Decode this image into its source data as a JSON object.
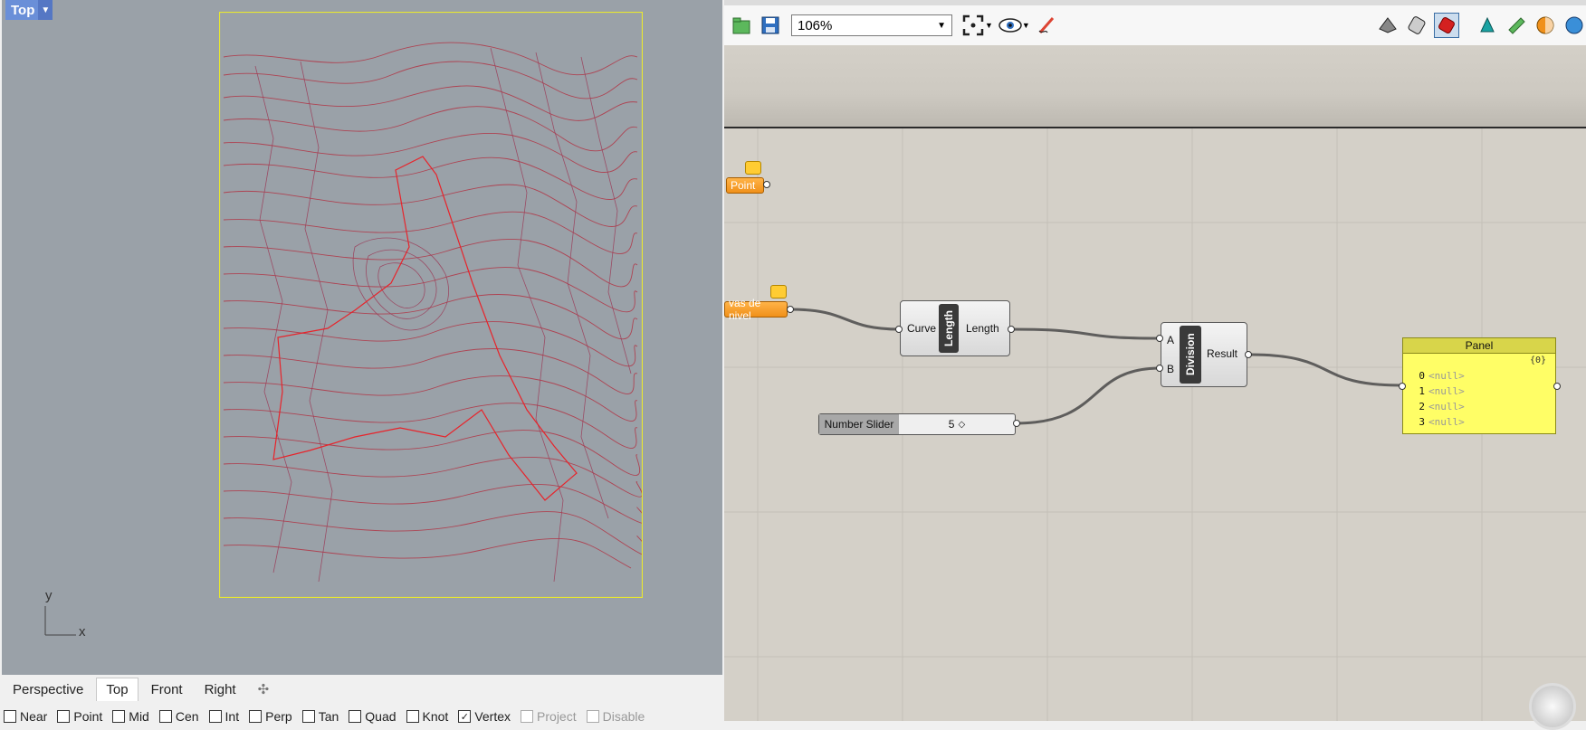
{
  "rhino": {
    "viewport_title": "Top",
    "axis_x": "x",
    "axis_y": "y",
    "viewport_tabs": [
      "Perspective",
      "Top",
      "Front",
      "Right"
    ],
    "active_tab": "Top",
    "osnaps": [
      {
        "label": "Near",
        "checked": false
      },
      {
        "label": "Point",
        "checked": false
      },
      {
        "label": "Mid",
        "checked": false
      },
      {
        "label": "Cen",
        "checked": false
      },
      {
        "label": "Int",
        "checked": false
      },
      {
        "label": "Perp",
        "checked": false
      },
      {
        "label": "Tan",
        "checked": false
      },
      {
        "label": "Quad",
        "checked": false
      },
      {
        "label": "Knot",
        "checked": false
      },
      {
        "label": "Vertex",
        "checked": true
      },
      {
        "label": "Project",
        "checked": false,
        "disabled": true
      },
      {
        "label": "Disable",
        "checked": false,
        "disabled": true
      }
    ]
  },
  "grasshopper": {
    "zoom": "106%",
    "components": {
      "point_param": "Point",
      "curves_param": "vas de nivel",
      "length": {
        "input": "Curve",
        "tag": "Length",
        "output": "Length"
      },
      "division": {
        "input_a": "A",
        "input_b": "B",
        "tag": "Division",
        "output": "Result"
      },
      "slider": {
        "label": "Number Slider",
        "value": "5"
      },
      "panel": {
        "title": "Panel",
        "path": "{0}",
        "rows": [
          {
            "index": "0",
            "value": "<null>"
          },
          {
            "index": "1",
            "value": "<null>"
          },
          {
            "index": "2",
            "value": "<null>"
          },
          {
            "index": "3",
            "value": "<null>"
          }
        ]
      }
    }
  },
  "colors": {
    "viewport_bg": "#9aa1a8",
    "contour": "#b03a4a",
    "boundary": "#e8232a",
    "frame": "#e8e830",
    "canvas_bg": "#d4d0c8",
    "param": "#f0901a",
    "panel": "#fffe66"
  }
}
